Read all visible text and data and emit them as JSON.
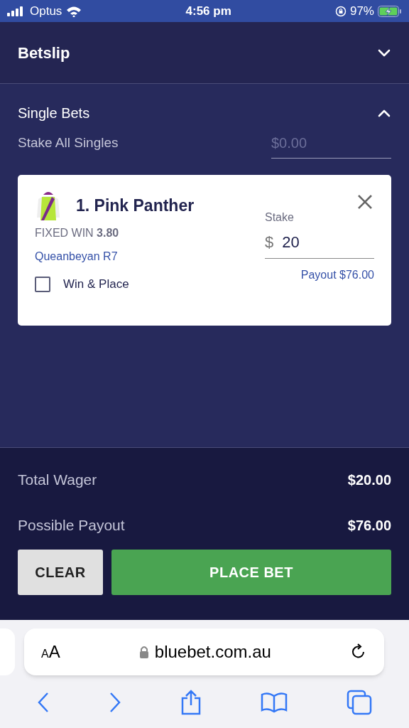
{
  "status_bar": {
    "carrier": "Optus",
    "time": "4:56 pm",
    "battery": "97%"
  },
  "header": {
    "title": "Betslip",
    "expanded": false
  },
  "section": {
    "title": "Single Bets",
    "expanded": true,
    "stake_all_label": "Stake All Singles",
    "stake_all_placeholder": "$0.00"
  },
  "bets": [
    {
      "title": "1. Pink Panther",
      "bet_type": "FIXED WIN **3.80**",
      "race": "Queanbeyan R7",
      "option_label": "Win & Place",
      "checked": false,
      "stake_label": "Stake",
      "currency": "$",
      "stake": "20",
      "payout": "Payout $76.00"
    }
  ],
  "totals": [
    {
      "label": "Total Wager",
      "value": "$20.00"
    },
    {
      "label": "Possible Payout",
      "value": "$76.00"
    }
  ],
  "buttons": [
    {
      "label": "CLEAR",
      "kind": "secondary"
    },
    {
      "label": "PLACE BET",
      "kind": "primary"
    }
  ],
  "browser": {
    "text_size": "AA",
    "url": "bluebet.com.au"
  }
}
